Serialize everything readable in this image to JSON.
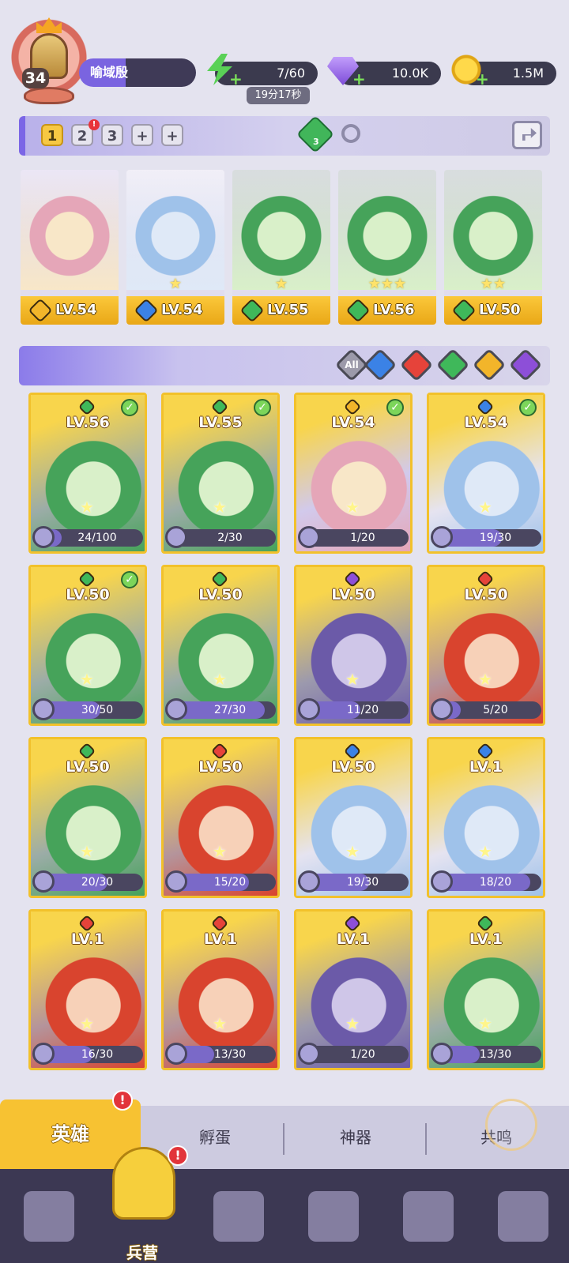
{
  "player": {
    "level": "34",
    "name": "喻域殷"
  },
  "resources": {
    "energy": "7/60",
    "energy_timer": "19分17秒",
    "gems": "10.0K",
    "coins": "1.5M"
  },
  "team_bar": {
    "slots": [
      {
        "label": "1",
        "active": true,
        "badge": ""
      },
      {
        "label": "2",
        "active": false,
        "badge": "!"
      },
      {
        "label": "3",
        "active": false,
        "badge": ""
      },
      {
        "label": "+",
        "active": false,
        "badge": ""
      },
      {
        "label": "+",
        "active": false,
        "badge": ""
      }
    ],
    "synergy_count": "3"
  },
  "team": [
    {
      "element": "light",
      "level": "LV.54",
      "stars": ""
    },
    {
      "element": "water",
      "level": "LV.54",
      "stars": "★"
    },
    {
      "element": "nature",
      "level": "LV.55",
      "stars": "★"
    },
    {
      "element": "nature",
      "level": "LV.56",
      "stars": "★★★"
    },
    {
      "element": "nature",
      "level": "LV.50",
      "stars": "★★"
    }
  ],
  "filters": {
    "all_label": "All",
    "elements": [
      "water",
      "fire",
      "nature",
      "light",
      "dark"
    ]
  },
  "heroes": [
    {
      "element": "nature",
      "level": "LV.56",
      "shards": "24/100",
      "progress": 0.24,
      "in_team": true
    },
    {
      "element": "nature",
      "level": "LV.55",
      "shards": "2/30",
      "progress": 0.07,
      "in_team": true
    },
    {
      "element": "light",
      "level": "LV.54",
      "shards": "1/20",
      "progress": 0.05,
      "in_team": true
    },
    {
      "element": "water",
      "level": "LV.54",
      "shards": "19/30",
      "progress": 0.63,
      "in_team": true
    },
    {
      "element": "nature",
      "level": "LV.50",
      "shards": "30/50",
      "progress": 0.6,
      "in_team": true
    },
    {
      "element": "nature",
      "level": "LV.50",
      "shards": "27/30",
      "progress": 0.9,
      "in_team": false
    },
    {
      "element": "dark",
      "level": "LV.50",
      "shards": "11/20",
      "progress": 0.55,
      "in_team": false
    },
    {
      "element": "fire",
      "level": "LV.50",
      "shards": "5/20",
      "progress": 0.25,
      "in_team": false
    },
    {
      "element": "nature",
      "level": "LV.50",
      "shards": "20/30",
      "progress": 0.67,
      "in_team": false
    },
    {
      "element": "fire",
      "level": "LV.50",
      "shards": "15/20",
      "progress": 0.75,
      "in_team": false
    },
    {
      "element": "water",
      "level": "LV.50",
      "shards": "19/30",
      "progress": 0.63,
      "in_team": false
    },
    {
      "element": "water",
      "level": "LV.1",
      "shards": "18/20",
      "progress": 0.9,
      "in_team": false
    },
    {
      "element": "fire",
      "level": "LV.1",
      "shards": "16/30",
      "progress": 0.53,
      "in_team": false
    },
    {
      "element": "fire",
      "level": "LV.1",
      "shards": "13/30",
      "progress": 0.43,
      "in_team": false
    },
    {
      "element": "dark",
      "level": "LV.1",
      "shards": "1/20",
      "progress": 0.05,
      "in_team": false
    },
    {
      "element": "nature",
      "level": "LV.1",
      "shards": "13/30",
      "progress": 0.43,
      "in_team": false
    }
  ],
  "sub_tabs": {
    "hero": "英雄",
    "hatch": "孵蛋",
    "artifact": "神器",
    "resonance": "共鸣",
    "hero_badge": "!"
  },
  "nav": {
    "barracks": "兵营",
    "barracks_badge": "!"
  },
  "colors": {
    "light": "#f2b52a",
    "water": "#3b82e6",
    "nature": "#3fb85a",
    "fire": "#e6433a",
    "dark": "#8d4fd8",
    "accent": "#7b66e6",
    "gold": "#f7c232"
  }
}
